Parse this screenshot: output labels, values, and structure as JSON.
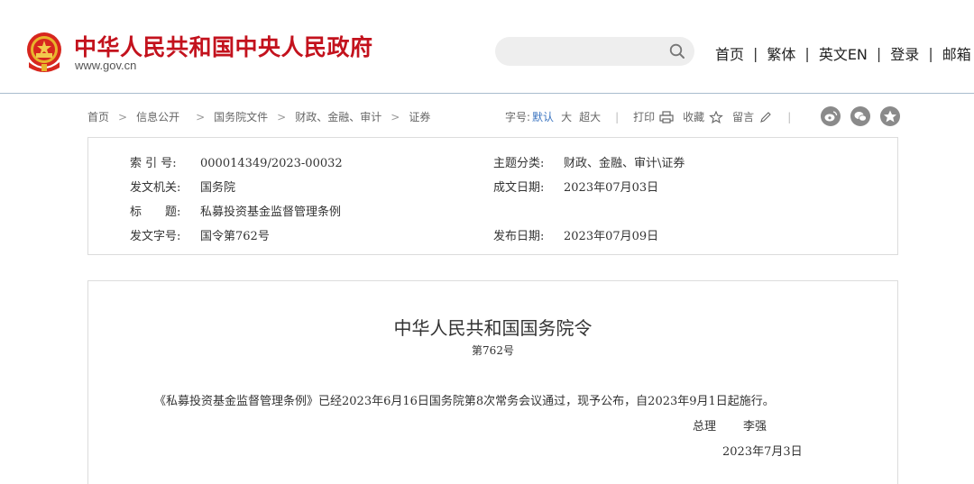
{
  "header": {
    "site_title": "中华人民共和国中央人民政府",
    "site_url": "www.gov.cn",
    "search_placeholder": "",
    "nav": [
      "首页",
      "繁体",
      "英文EN",
      "登录",
      "邮箱"
    ],
    "nav_separator": "|"
  },
  "breadcrumb": {
    "items": [
      "首页",
      "信息公开",
      "国务院文件",
      "财政、金融、审计",
      "证券"
    ],
    "separator": ">"
  },
  "tools": {
    "font_size_label": "字号:",
    "font_default": "默认",
    "font_large": "大",
    "font_xlarge": "超大",
    "divider": "|",
    "print": "打印",
    "favorite": "收藏",
    "comment": "留言"
  },
  "share_icons": [
    "weibo-icon",
    "wechat-icon",
    "qzone-icon"
  ],
  "info": {
    "index_label": "索 引 号:",
    "index_value": "000014349/2023-00032",
    "topic_label": "主题分类:",
    "topic_value": "财政、金融、审计\\证券",
    "issuer_label": "发文机关:",
    "issuer_value": "国务院",
    "written_label": "成文日期:",
    "written_value": "2023年07月03日",
    "title_label": "标　　题:",
    "title_value": "私募投资基金监督管理条例",
    "docno_label": "发文字号:",
    "docno_value": "国令第762号",
    "published_label": "发布日期:",
    "published_value": "2023年07月09日"
  },
  "document": {
    "title": "中华人民共和国国务院令",
    "number": "第762号",
    "body": "《私募投资基金监督管理条例》已经2023年6月16日国务院第8次常务会议通过，现予公布，自2023年9月1日起施行。",
    "signer_title": "总理",
    "signer_name": "李强",
    "date": "2023年7月3日"
  },
  "colors": {
    "brand_red": "#c3121d",
    "accent_blue": "#3d76c1",
    "header_border": "#a9bccd",
    "box_border": "#dcdcdc"
  }
}
